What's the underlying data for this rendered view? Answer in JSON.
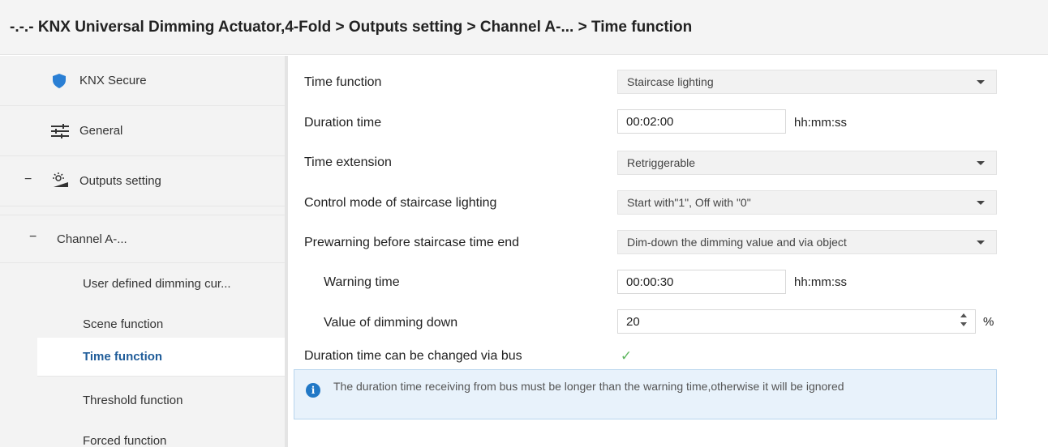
{
  "header": {
    "breadcrumb": "-.-.- KNX Universal Dimming Actuator,4-Fold > Outputs setting > Channel A-... > Time function"
  },
  "sidebar": {
    "items": [
      {
        "label": "KNX Secure",
        "icon": "shield-icon"
      },
      {
        "label": "General",
        "icon": "sliders-icon"
      },
      {
        "label": "Outputs setting",
        "icon": "outputs-icon",
        "toggle": "−"
      },
      {
        "label": "Channel A-...",
        "toggle": "−"
      }
    ],
    "sub_items": [
      {
        "label": "User defined dimming cur..."
      },
      {
        "label": "Scene function"
      },
      {
        "label": "Time function",
        "active": true
      },
      {
        "label": "Threshold function"
      },
      {
        "label": "Forced function"
      }
    ]
  },
  "form": {
    "time_function": {
      "label": "Time function",
      "value": "Staircase lighting"
    },
    "duration_time": {
      "label": "Duration time",
      "value": "00:02:00",
      "unit": "hh:mm:ss"
    },
    "time_extension": {
      "label": "Time extension",
      "value": "Retriggerable"
    },
    "control_mode": {
      "label": "Control mode of staircase lighting",
      "value": "Start with\"1\", Off with \"0\""
    },
    "prewarning": {
      "label": "Prewarning before staircase time end",
      "value": "Dim-down the dimming value and via object"
    },
    "warning_time": {
      "label": "Warning time",
      "value": "00:00:30",
      "unit": "hh:mm:ss"
    },
    "dimming_down": {
      "label": "Value of dimming down",
      "value": "20",
      "unit": "%"
    },
    "bus_change": {
      "label": "Duration time can be changed via bus",
      "checked": true,
      "check_glyph": "✓"
    }
  },
  "info": {
    "icon": "info-icon",
    "icon_glyph": "i",
    "text": "The duration time receiving from bus must be longer than the warning time,otherwise it will be ignored"
  },
  "colors": {
    "accent": "#1f5c99",
    "shield": "#2a7fd4",
    "check": "#5fb760",
    "info_bg": "#e8f2fb"
  }
}
